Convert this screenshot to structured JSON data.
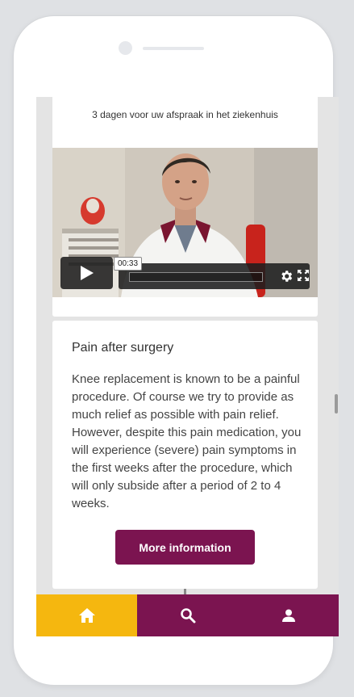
{
  "appointment": {
    "days_text": "3 dagen voor uw afspraak in het ziekenhuis"
  },
  "video": {
    "time": "00:33",
    "progress": 0.0
  },
  "info_card": {
    "title": "Pain after surgery",
    "body": "Knee replacement is known to be a painful procedure. Of course we try to provide as much relief as possible with pain relief. However, despite this pain medication, you will experience (severe) pain symptoms in the first weeks after the procedure, which will only subside after a period of 2 to 4 weeks.",
    "button_label": "More information"
  },
  "tabbar": {
    "active": "home",
    "items": [
      "home-icon",
      "search-icon",
      "profile-icon"
    ]
  },
  "colors": {
    "brand": "#7b1450",
    "accent": "#f5b70f"
  }
}
